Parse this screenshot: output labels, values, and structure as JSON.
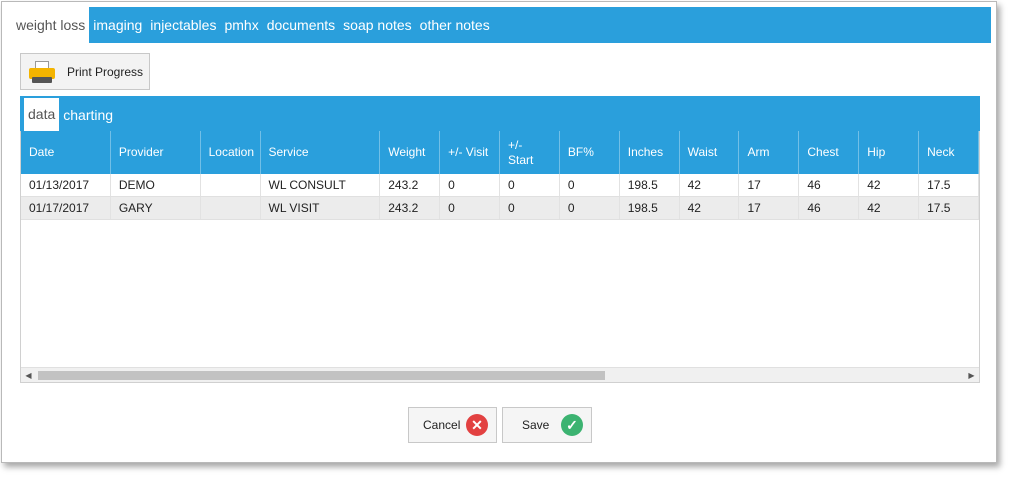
{
  "top_tabs": [
    {
      "label": "weight loss",
      "active": true
    },
    {
      "label": "imaging",
      "active": false
    },
    {
      "label": "injectables",
      "active": false
    },
    {
      "label": "pmhx",
      "active": false
    },
    {
      "label": "documents",
      "active": false
    },
    {
      "label": "soap notes",
      "active": false
    },
    {
      "label": "other notes",
      "active": false
    }
  ],
  "print_button": {
    "label": "Print Progress",
    "icon": "printer-icon"
  },
  "inner_tabs": [
    {
      "label": "data",
      "active": true
    },
    {
      "label": "charting",
      "active": false
    }
  ],
  "grid": {
    "columns": [
      "Date",
      "Provider",
      "Location",
      "Service",
      "Weight",
      "+/- Visit",
      "+/-\nStart",
      "BF%",
      "Inches",
      "Waist",
      "Arm",
      "Chest",
      "Hip",
      "Neck"
    ],
    "rows": [
      [
        "01/13/2017",
        "DEMO",
        "",
        "WL CONSULT",
        "243.2",
        "0",
        "0",
        "0",
        "198.5",
        "42",
        "17",
        "46",
        "42",
        "17.5"
      ],
      [
        "01/17/2017",
        "GARY",
        "",
        "WL VISIT",
        "243.2",
        "0",
        "0",
        "0",
        "198.5",
        "42",
        "17",
        "46",
        "42",
        "17.5"
      ]
    ]
  },
  "scrollbar": {
    "left_arrow": "◀",
    "right_arrow": "▶"
  },
  "cancel_button": {
    "label": "Cancel",
    "icon": "✕"
  },
  "save_button": {
    "label": "Save",
    "icon": "✓"
  },
  "colors": {
    "accent": "#2a9fdc",
    "cancel": "#e24141",
    "save": "#3cb371"
  }
}
